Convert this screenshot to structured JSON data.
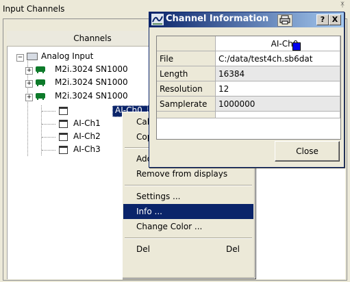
{
  "panel": {
    "title": "Input Channels",
    "column_header": "Channels",
    "pin_glyph": "ᛡ"
  },
  "tree": {
    "root": {
      "label": "Analog Input",
      "expander": "⊟"
    },
    "cards": [
      {
        "label": "M2i.3024 SN1000",
        "expander": "+"
      },
      {
        "label": "M2i.3024 SN1000",
        "expander": "+"
      },
      {
        "label": "M2i.3024 SN1000",
        "expander": "+"
      }
    ],
    "channels": [
      "AI-Ch0",
      "AI-Ch1",
      "AI-Ch2",
      "AI-Ch3"
    ]
  },
  "context_menu": {
    "items": [
      {
        "label": "Cal",
        "shortcut": ""
      },
      {
        "label": "Cop",
        "shortcut": ""
      },
      {
        "label": "Ado",
        "shortcut": ""
      },
      {
        "label": "Remove from displays",
        "shortcut": ""
      },
      {
        "label": "Settings ...",
        "shortcut": ""
      },
      {
        "label": "Info ...",
        "shortcut": "",
        "selected": true
      },
      {
        "label": "Change Color ...",
        "shortcut": ""
      },
      {
        "label": "Del",
        "shortcut": "Del"
      }
    ]
  },
  "dialog": {
    "title": "Channel Information",
    "help_button": "?",
    "close_button_glyph": "X",
    "channel_name": "AI-Ch0",
    "channel_color": "#0000ee",
    "rows": [
      {
        "label": "File",
        "value": "C:/data/test4ch.sb6dat"
      },
      {
        "label": "Length",
        "value": "16384"
      },
      {
        "label": "Resolution",
        "value": "12"
      },
      {
        "label": "Samplerate",
        "value": "1000000"
      }
    ],
    "close_label": "Close"
  },
  "colors": {
    "selection": "#0a246a",
    "window_bg": "#ece9d8",
    "chip_green": "#0d7a2a"
  }
}
